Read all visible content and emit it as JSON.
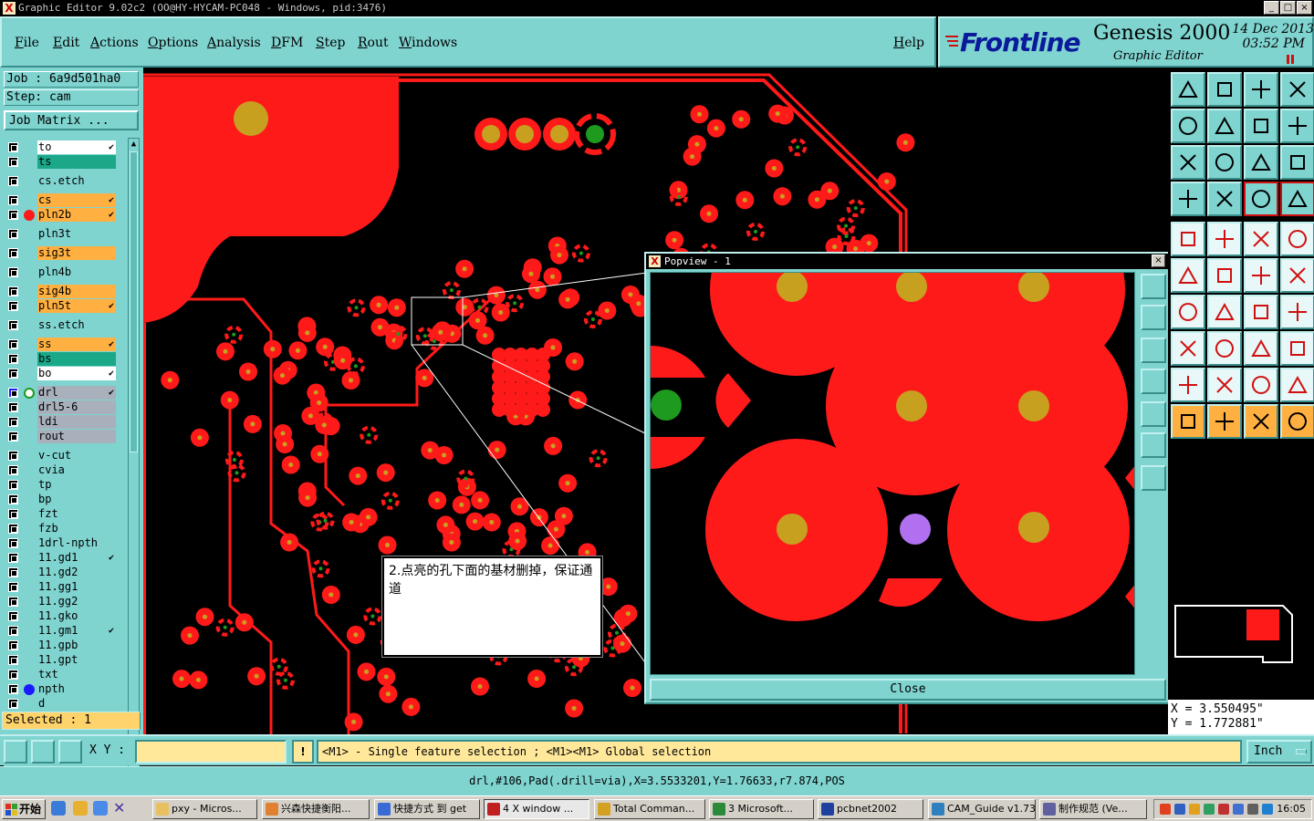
{
  "window": {
    "title": "Graphic Editor 9.02c2 (OO@HY-HYCAM-PC048 - Windows, pid:3476)",
    "controls": {
      "minimize": "_",
      "maximize": "□",
      "close": "×"
    }
  },
  "menu": [
    "File",
    "Edit",
    "Actions",
    "Options",
    "Analysis",
    "DFM",
    "Step",
    "Rout",
    "Windows"
  ],
  "help": "Help",
  "logo": {
    "brand": "Frontline",
    "product": "Genesis 2000",
    "subtitle": "Graphic Editor",
    "date": "14 Dec 2013",
    "time": "03:52 PM"
  },
  "job": {
    "job_label": "Job : 6a9d501ha0",
    "step_label": "Step: cam",
    "matrix_button": "Job Matrix ..."
  },
  "layers": [
    {
      "name": "to",
      "color": "#ffffff",
      "affected": true,
      "group": 0
    },
    {
      "name": "ts",
      "color": "#1aa889",
      "affected": false,
      "group": 0
    },
    {
      "name": "cs.etch",
      "color": "#7fd4d0",
      "affected": false,
      "group": 1
    },
    {
      "name": "cs",
      "color": "#ffb040",
      "affected": true,
      "group": 2
    },
    {
      "name": "pln2b",
      "color": "#ffb040",
      "affected": true,
      "group": 2,
      "dot": "#ff1a1a"
    },
    {
      "name": "pln3t",
      "color": "#7fd4d0",
      "affected": false,
      "group": 3
    },
    {
      "name": "sig3t",
      "color": "#ffb040",
      "affected": false,
      "group": 4
    },
    {
      "name": "pln4b",
      "color": "#7fd4d0",
      "affected": false,
      "group": 5
    },
    {
      "name": "sig4b",
      "color": "#ffb040",
      "affected": false,
      "group": 6
    },
    {
      "name": "pln5t",
      "color": "#ffb040",
      "affected": true,
      "group": 6
    },
    {
      "name": "ss.etch",
      "color": "#7fd4d0",
      "affected": false,
      "group": 7
    },
    {
      "name": "ss",
      "color": "#ffb040",
      "affected": true,
      "group": 8
    },
    {
      "name": "bs",
      "color": "#1aa889",
      "affected": false,
      "group": 8
    },
    {
      "name": "bo",
      "color": "#ffffff",
      "affected": true,
      "group": 8
    },
    {
      "name": "drl",
      "color": "#a8b0bc",
      "affected": true,
      "group": 9,
      "work": true
    },
    {
      "name": "drl5-6",
      "color": "#a8b0bc",
      "affected": false,
      "group": 9
    },
    {
      "name": "ldi",
      "color": "#a8b0bc",
      "affected": false,
      "group": 9
    },
    {
      "name": "rout",
      "color": "#a8b0bc",
      "affected": false,
      "group": 9
    },
    {
      "name": "v-cut",
      "color": "#7fd4d0",
      "affected": false,
      "group": 10
    },
    {
      "name": "cvia",
      "color": "#7fd4d0",
      "affected": false,
      "group": 10
    },
    {
      "name": "tp",
      "color": "#7fd4d0",
      "affected": false,
      "group": 10
    },
    {
      "name": "bp",
      "color": "#7fd4d0",
      "affected": false,
      "group": 10
    },
    {
      "name": "fzt",
      "color": "#7fd4d0",
      "affected": false,
      "group": 10
    },
    {
      "name": "fzb",
      "color": "#7fd4d0",
      "affected": false,
      "group": 10
    },
    {
      "name": "1drl-npth",
      "color": "#7fd4d0",
      "affected": false,
      "group": 10
    },
    {
      "name": "11.gd1",
      "color": "#7fd4d0",
      "affected": true,
      "group": 10
    },
    {
      "name": "11.gd2",
      "color": "#7fd4d0",
      "affected": false,
      "group": 10
    },
    {
      "name": "11.gg1",
      "color": "#7fd4d0",
      "affected": false,
      "group": 10
    },
    {
      "name": "11.gg2",
      "color": "#7fd4d0",
      "affected": false,
      "group": 10
    },
    {
      "name": "11.gko",
      "color": "#7fd4d0",
      "affected": false,
      "group": 10
    },
    {
      "name": "11.gm1",
      "color": "#7fd4d0",
      "affected": true,
      "group": 10
    },
    {
      "name": "11.gpb",
      "color": "#7fd4d0",
      "affected": false,
      "group": 10
    },
    {
      "name": "11.gpt",
      "color": "#7fd4d0",
      "affected": false,
      "group": 10
    },
    {
      "name": "txt",
      "color": "#7fd4d0",
      "affected": false,
      "group": 10
    },
    {
      "name": "npth",
      "color": "#7fd4d0",
      "affected": false,
      "group": 10,
      "dot": "#1a1aff"
    },
    {
      "name": "d",
      "color": "#7fd4d0",
      "affected": false,
      "group": 10
    }
  ],
  "selected": "Selected : 1",
  "annotation": "2.点亮的孔下面的基材删掉，保证通道",
  "popview": {
    "title": "Popview - 1",
    "close_button": "Close"
  },
  "coords": {
    "x": "X = 3.550495\"",
    "y": "Y = 1.772881\""
  },
  "bottom": {
    "xy_label": "X Y :",
    "xy_value": "",
    "warn": "!",
    "hint": "<M1> - Single feature selection ; <M1><M1> Global selection",
    "units": "Inch"
  },
  "feature_info": "drl,#106,Pad(.drill=via),X=3.5533201,Y=1.76633,r7.874,POS",
  "taskbar": {
    "start": "开始",
    "tasks": [
      {
        "label": "pxy - Micros...",
        "color": "#e8c060"
      },
      {
        "label": "兴森快捷衡阳...",
        "color": "#e08030"
      },
      {
        "label": "快捷方式 到 get",
        "color": "#3a6ad4"
      },
      {
        "label": "4 X window ...",
        "color": "#c02020"
      },
      {
        "label": "Total Comman...",
        "color": "#d4a020"
      },
      {
        "label": "3 Microsoft...",
        "color": "#2a8a3a"
      },
      {
        "label": "pcbnet2002",
        "color": "#2040a0"
      },
      {
        "label": "CAM_Guide v1.73",
        "color": "#3080c0"
      },
      {
        "label": "制作规范 (Ve...",
        "color": "#6060a0"
      }
    ],
    "clock": "16:05"
  },
  "colors": {
    "panel": "#7fd4d0",
    "copper": "#ff1a1a",
    "drill_gold": "#c8a020",
    "drill_green": "#1e9a1e",
    "highlight": "#b070f0",
    "note_bg": "#ffffff"
  }
}
